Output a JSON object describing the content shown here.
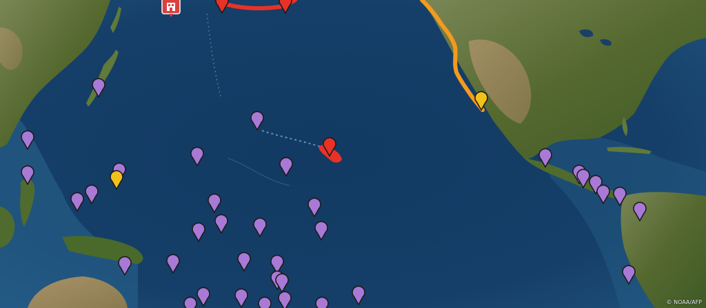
{
  "map": {
    "credit": "© NOAA/AFP",
    "colors": {
      "ocean": "#143c66",
      "land": "#6b7a45",
      "epicenter": "#e83228",
      "warning_coast": "#f59a1e",
      "station_marker": "#a979d6",
      "threat_marker": "#f2c21a",
      "hazard_icon": "#d9413f"
    },
    "markers": {
      "station_color": "station_marker",
      "threat_color": "threat_marker",
      "epicenter_color": "epicenter",
      "warning_color": "warning_coast",
      "station_count": 44,
      "threat_count": 2
    },
    "icons": [
      "map-pin-icon",
      "hazard-building-icon"
    ]
  }
}
